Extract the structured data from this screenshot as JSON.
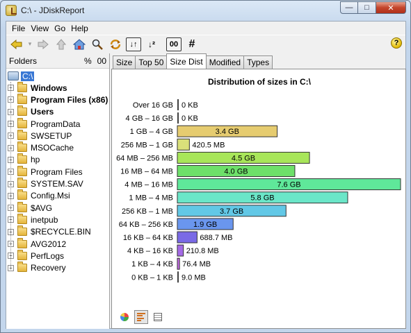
{
  "window": {
    "title": "C:\\ - JDiskReport"
  },
  "menu": [
    "File",
    "View",
    "Go",
    "Help"
  ],
  "toolbar": {
    "sort_label": "↓↑",
    "sort_alpha_label": "↓²",
    "digits_label": "00",
    "hash_label": "#"
  },
  "folders": {
    "header": "Folders",
    "percent_label": "%",
    "digits_label": "00",
    "root": "C:\\",
    "items": [
      {
        "label": "Windows",
        "bold": true
      },
      {
        "label": "Program Files (x86)",
        "bold": true
      },
      {
        "label": "Users",
        "bold": true
      },
      {
        "label": "ProgramData",
        "bold": false
      },
      {
        "label": "SWSETUP",
        "bold": false
      },
      {
        "label": "MSOCache",
        "bold": false
      },
      {
        "label": "hp",
        "bold": false
      },
      {
        "label": "Program Files",
        "bold": false
      },
      {
        "label": "SYSTEM.SAV",
        "bold": false
      },
      {
        "label": "Config.Msi",
        "bold": false
      },
      {
        "label": "$AVG",
        "bold": false
      },
      {
        "label": "inetpub",
        "bold": false
      },
      {
        "label": "$RECYCLE.BIN",
        "bold": false
      },
      {
        "label": "AVG2012",
        "bold": false
      },
      {
        "label": "PerfLogs",
        "bold": false
      },
      {
        "label": "Recovery",
        "bold": false
      }
    ]
  },
  "tabs": [
    "Size",
    "Top 50",
    "Size Dist",
    "Modified",
    "Types"
  ],
  "active_tab": "Size Dist",
  "chart_data": {
    "type": "bar",
    "orientation": "horizontal",
    "title": "Distribution of sizes in C:\\",
    "categories": [
      "Over 16 GB",
      "4 GB – 16 GB",
      "1 GB – 4 GB",
      "256 MB – 1 GB",
      "64 MB – 256 MB",
      "16 MB – 64 MB",
      "4 MB – 16 MB",
      "1 MB – 4 MB",
      "256 KB – 1 MB",
      "64 KB – 256 KB",
      "16 KB – 64 KB",
      "4 KB – 16 KB",
      "1 KB – 4 KB",
      "0 KB – 1 KB"
    ],
    "values_mb": [
      0,
      0,
      3481.6,
      420.5,
      4608,
      4096,
      7782.4,
      5939.2,
      3788.8,
      1945.6,
      688.7,
      210.8,
      76.4,
      9.0
    ],
    "labels": [
      "0 KB",
      "0 KB",
      "3.4 GB",
      "420.5 MB",
      "4.5 GB",
      "4.0 GB",
      "7.6 GB",
      "5.8 GB",
      "3.7 GB",
      "1.9 GB",
      "688.7 MB",
      "210.8 MB",
      "76.4 MB",
      "9.0 MB"
    ],
    "colors": [
      "#404040",
      "#404040",
      "#e6cc70",
      "#d9e07a",
      "#a8e65a",
      "#6ee06a",
      "#5fe89a",
      "#6be6c8",
      "#62c8e6",
      "#6a96ee",
      "#7a6ae6",
      "#a46ae6",
      "#c46ae6",
      "#404040"
    ],
    "grid": false,
    "legend": "none"
  }
}
